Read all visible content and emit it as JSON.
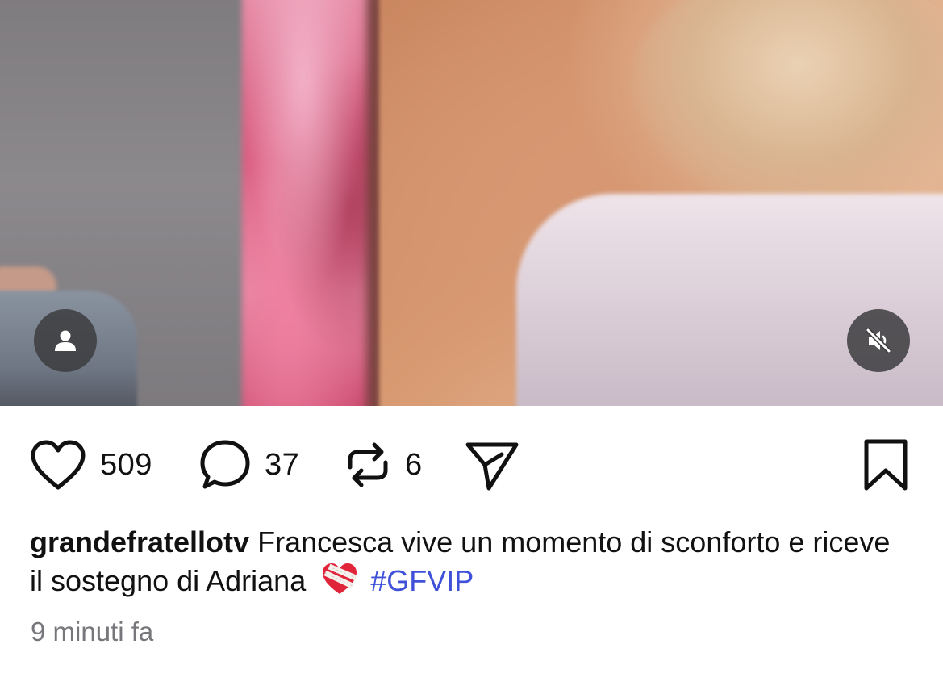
{
  "post": {
    "media": {
      "user_tag_icon": "person-icon",
      "mute_icon": "speaker-muted-icon"
    },
    "actions": {
      "like": {
        "icon": "heart-icon",
        "count": "509"
      },
      "comment": {
        "icon": "speech-bubble-icon",
        "count": "37"
      },
      "repost": {
        "icon": "repost-arrows-icon",
        "count": "6"
      },
      "share": {
        "icon": "paper-plane-icon"
      },
      "save": {
        "icon": "bookmark-icon"
      }
    },
    "caption": {
      "username": "grandefratellotv",
      "text": "Francesca vive un momento di sconforto e riceve il sostegno di Adriana",
      "emoji": "❤️‍🩹",
      "hashtag": "#GFVIP"
    },
    "timestamp": "9 minuti fa"
  },
  "colors": {
    "hashtag": "#3f51d8",
    "timestamp": "#77777b",
    "text": "#111111"
  }
}
